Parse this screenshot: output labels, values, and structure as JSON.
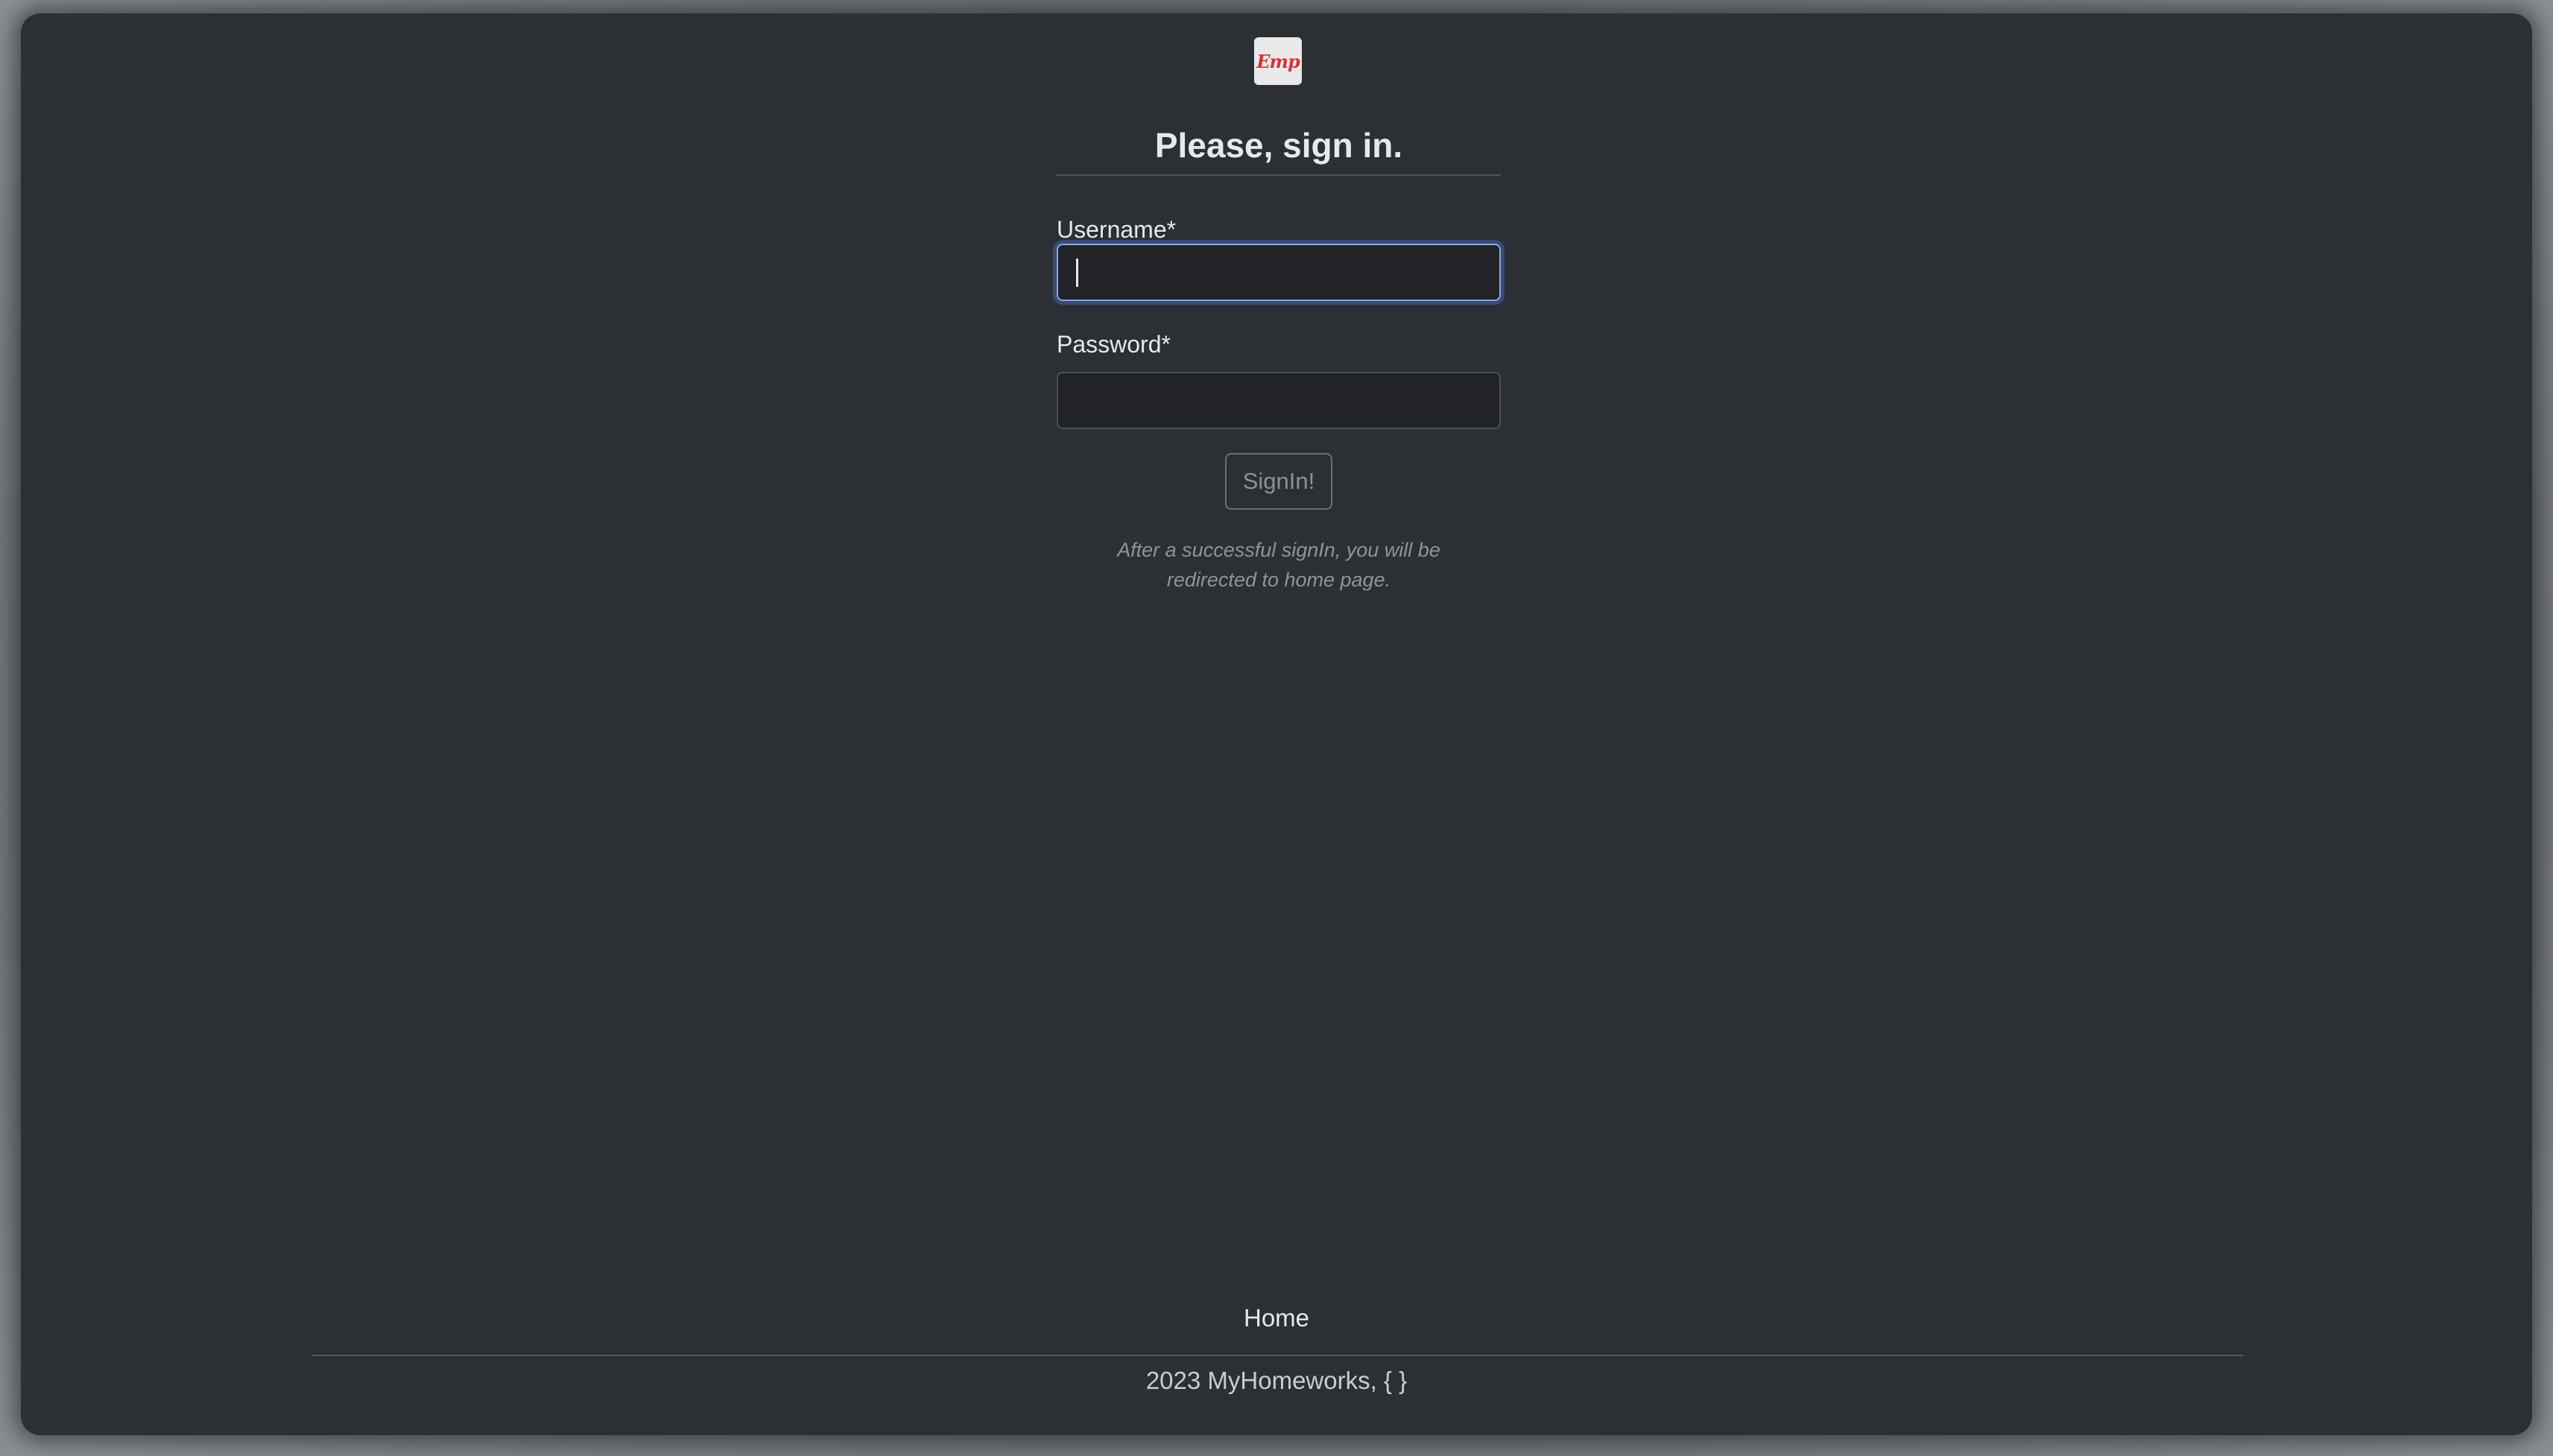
{
  "logo": {
    "text": "Emp"
  },
  "form": {
    "title": "Please, sign in.",
    "username_label": "Username*",
    "username_value": "",
    "password_label": "Password*",
    "password_value": "",
    "submit_label": "SignIn!",
    "note": "After a successful signIn, you will be redirected to home page."
  },
  "footer": {
    "link_home": "Home",
    "copyright": "2023 MyHomeworks, { }"
  },
  "colors": {
    "background": "#2c2f34",
    "focus_ring": "#8ea6dd",
    "logo_accent": "#d8323a"
  }
}
